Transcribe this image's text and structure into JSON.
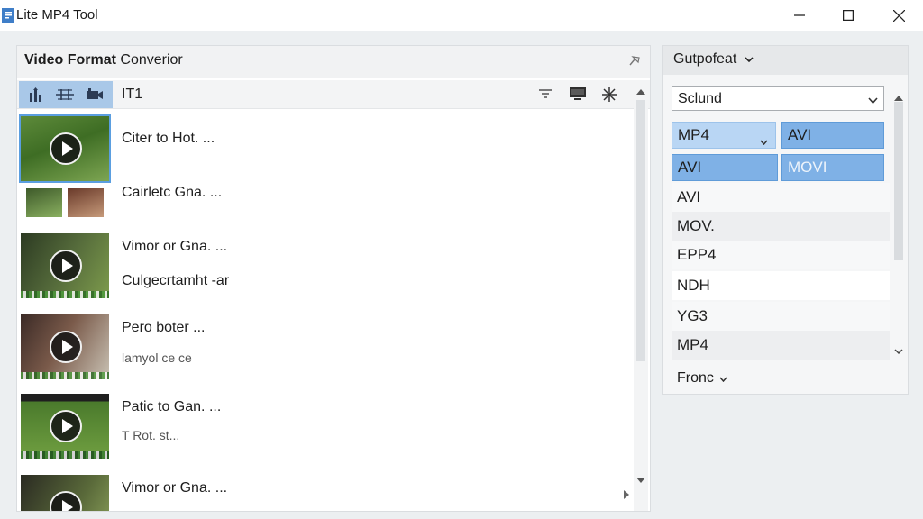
{
  "window": {
    "title": "Lite MP4 Tool",
    "controls": [
      "minimize",
      "maximize",
      "close"
    ]
  },
  "left_panel": {
    "title_bold": "Video Format",
    "title_rest": " Converior",
    "toolbar_label": "IT1",
    "icons": [
      "sort-icon",
      "split-icon",
      "film-icon",
      "filter-icon",
      "monitor-icon",
      "asterisk-icon",
      "pin-icon"
    ]
  },
  "files": [
    {
      "title": "Citer to Hot. ...",
      "subtitle": ""
    },
    {
      "title": "Cairletc Gna. ...",
      "subtitle": ""
    },
    {
      "title": "Vimor or Gna. ...",
      "subtitle": ""
    },
    {
      "title": "Culgecrtamht -ar",
      "subtitle": ""
    },
    {
      "title": "Pero boter ...",
      "subtitle": "lamyol ce ce"
    },
    {
      "title": "Patic to Gan. ...",
      "subtitle": "T Rot. st..."
    },
    {
      "title": "Vimor or Gna. ...",
      "subtitle": ""
    }
  ],
  "right_panel": {
    "header": "Gutpofeat",
    "select_value": "Sclund",
    "chips": [
      {
        "label": "MP4",
        "style": "light",
        "has_dropdown": true
      },
      {
        "label": "AVI",
        "style": "dark",
        "has_dropdown": false
      },
      {
        "label": "AVI",
        "style": "dark",
        "has_dropdown": false
      },
      {
        "label": "MOVI",
        "style": "dark",
        "has_dropdown": false
      }
    ],
    "formats": [
      "AVI",
      "MOV.",
      "EPP4",
      "NDH",
      "YG3",
      "MP4"
    ],
    "more_label": "Fronc"
  },
  "colors": {
    "accent_light": "#b9d6f4",
    "accent_dark": "#7fb1e6",
    "toolbar_group": "#a9c8e8"
  }
}
